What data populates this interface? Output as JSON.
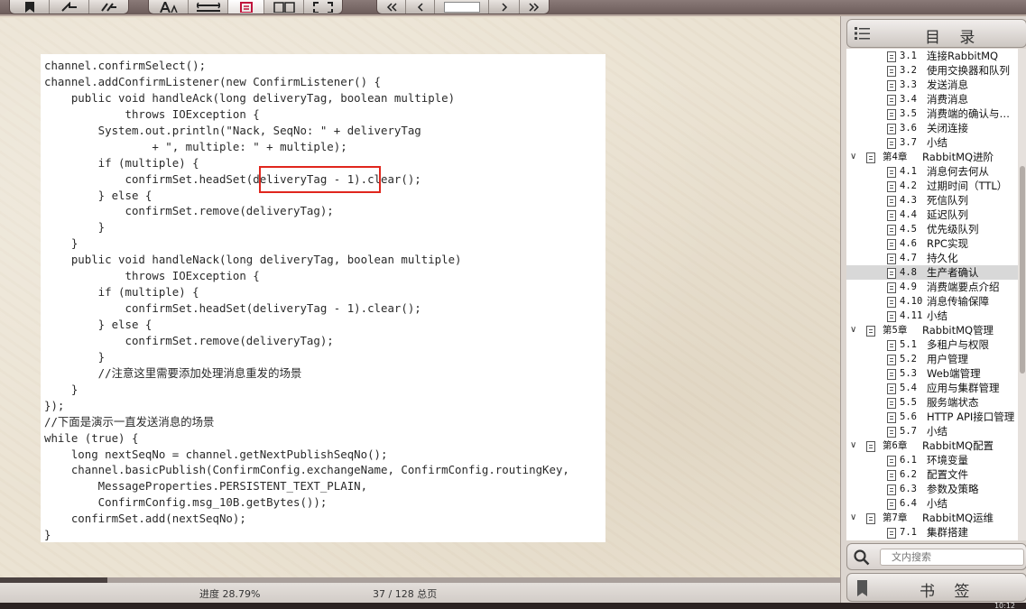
{
  "code_lines": [
    "channel.confirmSelect();",
    "channel.addConfirmListener(new ConfirmListener() {",
    "    public void handleAck(long deliveryTag, boolean multiple)",
    "            throws IOException {",
    "        System.out.println(\"Nack, SeqNo: \" + deliveryTag",
    "                + \", multiple: \" + multiple);",
    "        if (multiple) {",
    "            confirmSet.headSet(deliveryTag - 1).clear();",
    "        } else {",
    "            confirmSet.remove(deliveryTag);",
    "        }",
    "    }",
    "    public void handleNack(long deliveryTag, boolean multiple)",
    "            throws IOException {",
    "        if (multiple) {",
    "            confirmSet.headSet(deliveryTag - 1).clear();",
    "        } else {",
    "            confirmSet.remove(deliveryTag);",
    "        }",
    "        //注意这里需要添加处理消息重发的场景",
    "    }",
    "});",
    "//下面是演示一直发送消息的场景",
    "while (true) {",
    "    long nextSeqNo = channel.getNextPublishSeqNo();",
    "    channel.basicPublish(ConfirmConfig.exchangeName, ConfirmConfig.routingKey,",
    "        MessageProperties.PERSISTENT_TEXT_PLAIN,",
    "        ConfirmConfig.msg_10B.getBytes());",
    "    confirmSet.add(nextSeqNo);",
    "}"
  ],
  "status": {
    "progress_label": "进度 28.79%",
    "progress_fraction": 0.1277,
    "page_count": "37 / 128 总页",
    "clock": "10:12"
  },
  "sidebar": {
    "toc_title": "目 录",
    "search_placeholder": "文内搜索",
    "bookmark_title": "书 签",
    "items": [
      {
        "level": "section",
        "num": "3.1",
        "label": "连接RabbitMQ"
      },
      {
        "level": "section",
        "num": "3.2",
        "label": "使用交换器和队列"
      },
      {
        "level": "section",
        "num": "3.3",
        "label": "发送消息"
      },
      {
        "level": "section",
        "num": "3.4",
        "label": "消费消息"
      },
      {
        "level": "section",
        "num": "3.5",
        "label": "消费端的确认与…"
      },
      {
        "level": "section",
        "num": "3.6",
        "label": "关闭连接"
      },
      {
        "level": "section",
        "num": "3.7",
        "label": "小结"
      },
      {
        "level": "chapter",
        "num": "第4章",
        "label": "RabbitMQ进阶",
        "toggle": "∨"
      },
      {
        "level": "section",
        "num": "4.1",
        "label": "消息何去何从"
      },
      {
        "level": "section",
        "num": "4.2",
        "label": "过期时间（TTL）"
      },
      {
        "level": "section",
        "num": "4.3",
        "label": "死信队列"
      },
      {
        "level": "section",
        "num": "4.4",
        "label": "延迟队列"
      },
      {
        "level": "section",
        "num": "4.5",
        "label": "优先级队列"
      },
      {
        "level": "section",
        "num": "4.6",
        "label": "RPC实现"
      },
      {
        "level": "section",
        "num": "4.7",
        "label": "持久化"
      },
      {
        "level": "section",
        "num": "4.8",
        "label": "生产者确认",
        "selected": true
      },
      {
        "level": "section",
        "num": "4.9",
        "label": "消费端要点介绍"
      },
      {
        "level": "section",
        "num": "4.10",
        "label": "消息传输保障"
      },
      {
        "level": "section",
        "num": "4.11",
        "label": "小结"
      },
      {
        "level": "chapter",
        "num": "第5章",
        "label": "RabbitMQ管理",
        "toggle": "∨"
      },
      {
        "level": "section",
        "num": "5.1",
        "label": "多租户与权限"
      },
      {
        "level": "section",
        "num": "5.2",
        "label": "用户管理"
      },
      {
        "level": "section",
        "num": "5.3",
        "label": "Web端管理"
      },
      {
        "level": "section",
        "num": "5.4",
        "label": "应用与集群管理"
      },
      {
        "level": "section",
        "num": "5.5",
        "label": "服务端状态"
      },
      {
        "level": "section",
        "num": "5.6",
        "label": "HTTP API接口管理"
      },
      {
        "level": "section",
        "num": "5.7",
        "label": "小结"
      },
      {
        "level": "chapter",
        "num": "第6章",
        "label": "RabbitMQ配置",
        "toggle": "∨"
      },
      {
        "level": "section",
        "num": "6.1",
        "label": "环境变量"
      },
      {
        "level": "section",
        "num": "6.2",
        "label": "配置文件"
      },
      {
        "level": "section",
        "num": "6.3",
        "label": "参数及策略"
      },
      {
        "level": "section",
        "num": "6.4",
        "label": "小结"
      },
      {
        "level": "chapter",
        "num": "第7章",
        "label": "RabbitMQ运维",
        "toggle": "∨"
      },
      {
        "level": "section",
        "num": "7.1",
        "label": "集群搭建"
      }
    ]
  },
  "colors": {
    "highlight_box": "#e0261d",
    "selected_row": "#d8d8d8"
  },
  "icons": {
    "toolbar_left": [
      "bookmark-add-icon",
      "forward-icon",
      "double-forward-icon"
    ],
    "toolbar_mid": [
      "font-size-icon",
      "fit-width-icon",
      "single-page-icon",
      "two-page-icon",
      "fullscreen-icon"
    ],
    "toolbar_nav": [
      "first-page-icon",
      "prev-page-icon",
      "next-page-icon",
      "last-page-icon"
    ]
  }
}
